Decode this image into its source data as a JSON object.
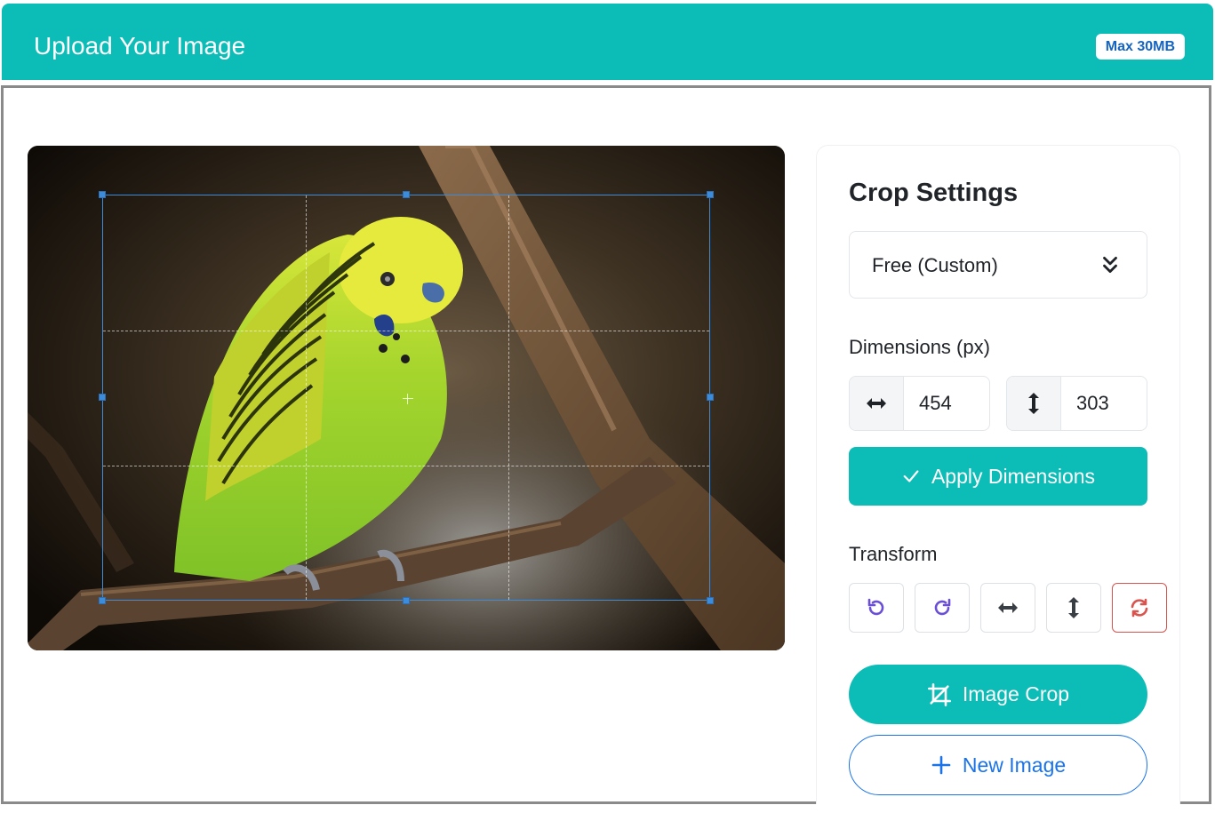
{
  "header": {
    "title": "Upload Your Image",
    "badge": "Max 30MB"
  },
  "image": {
    "subject": "budgerigar",
    "crop_grid": "rule-of-thirds"
  },
  "settings": {
    "title": "Crop Settings",
    "aspect_select": {
      "selected": "Free (Custom)"
    },
    "dimensions": {
      "label": "Dimensions (px)",
      "width": "454",
      "height": "303",
      "width_icon": "arrows-horizontal-icon",
      "height_icon": "arrows-vertical-icon"
    },
    "apply_label": "Apply Dimensions",
    "transform": {
      "label": "Transform",
      "buttons": [
        "rotate-left-icon",
        "rotate-right-icon",
        "flip-horizontal-icon",
        "flip-vertical-icon",
        "reset-icon"
      ]
    },
    "crop_label": "Image Crop",
    "new_image_label": "New Image"
  },
  "colors": {
    "accent": "#0cbcb7",
    "link_blue": "#1a73e8",
    "rotate_purple": "#6a4fd6",
    "reset_red": "#d9534f",
    "crop_frame": "#3d8bdb"
  }
}
